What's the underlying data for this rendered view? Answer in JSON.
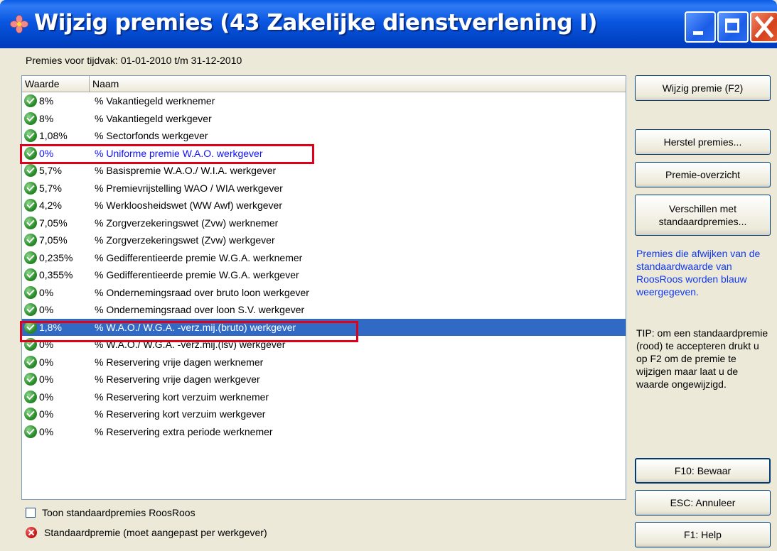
{
  "window": {
    "title": "Wijzig premies (43 Zakelijke dienstverlening I)"
  },
  "period": {
    "label": "Premies voor tijdvak:",
    "value": "01-01-2010 t/m 31-12-2010"
  },
  "table": {
    "columns": [
      "Waarde",
      "Naam"
    ],
    "rows": [
      {
        "value": "8%",
        "name": "% Vakantiegeld werknemer"
      },
      {
        "value": "8%",
        "name": "% Vakantiegeld werkgever"
      },
      {
        "value": "1,08%",
        "name": "% Sectorfonds werkgever"
      },
      {
        "value": "0%",
        "name": "% Uniforme premie W.A.O. werkgever",
        "state": "blue"
      },
      {
        "value": "5,7%",
        "name": "% Basispremie W.A.O./ W.I.A. werkgever"
      },
      {
        "value": "5,7%",
        "name": "% Premievrijstelling WAO / WIA werkgever"
      },
      {
        "value": "4,2%",
        "name": "% Werkloosheidswet (WW Awf) werkgever"
      },
      {
        "value": "7,05%",
        "name": "% Zorgverzekeringswet (Zvw) werknemer"
      },
      {
        "value": "7,05%",
        "name": "% Zorgverzekeringswet (Zvw) werkgever"
      },
      {
        "value": "0,235%",
        "name": "% Gedifferentieerde premie W.G.A. werknemer"
      },
      {
        "value": "0,355%",
        "name": "% Gedifferentieerde premie W.G.A. werkgever"
      },
      {
        "value": "0%",
        "name": "% Ondernemingsraad over bruto loon werkgever"
      },
      {
        "value": "0%",
        "name": "% Ondernemingsraad over loon S.V. werkgever"
      },
      {
        "value": "1,8%",
        "name": "% W.A.O./ W.G.A. -verz.mij.(bruto) werkgever",
        "state": "selected"
      },
      {
        "value": "0%",
        "name": "% W.A.O./ W.G.A. -verz.mij.(lsv) werkgever"
      },
      {
        "value": "0%",
        "name": "% Reservering vrije dagen werknemer"
      },
      {
        "value": "0%",
        "name": "% Reservering vrije dagen werkgever"
      },
      {
        "value": "0%",
        "name": "% Reservering kort verzuim werknemer"
      },
      {
        "value": "0%",
        "name": "% Reservering kort verzuim werkgever"
      },
      {
        "value": "0%",
        "name": "% Reservering extra periode werknemer"
      }
    ]
  },
  "buttons": {
    "edit": "Wijzig premie (F2)",
    "restore": "Herstel premies...",
    "overview": "Premie-overzicht",
    "diff_line1": "Verschillen met",
    "diff_line2": "standaardpremies...",
    "save": "F10: Bewaar",
    "cancel": "ESC: Annuleer",
    "help": "F1: Help"
  },
  "info": {
    "blue_note": "Premies die afwijken van de standaardwaarde van RoosRoos worden blauw weergegeven.",
    "tip": "TIP: om een standaardpremie (rood) te accepteren drukt u op F2 om de premie te wijzigen maar laat u de waarde ongewijzigd."
  },
  "footer": {
    "show_defaults_label": "Toon standaardpremies RoosRoos",
    "show_defaults_checked": false,
    "legend_label": "Standaardpremie (moet aangepast per werkgever)"
  },
  "colors": {
    "title_bar": "#0a56e0",
    "selection": "#316ac5",
    "highlight_box": "#e0001a",
    "deviation_text": "#1010ff"
  }
}
